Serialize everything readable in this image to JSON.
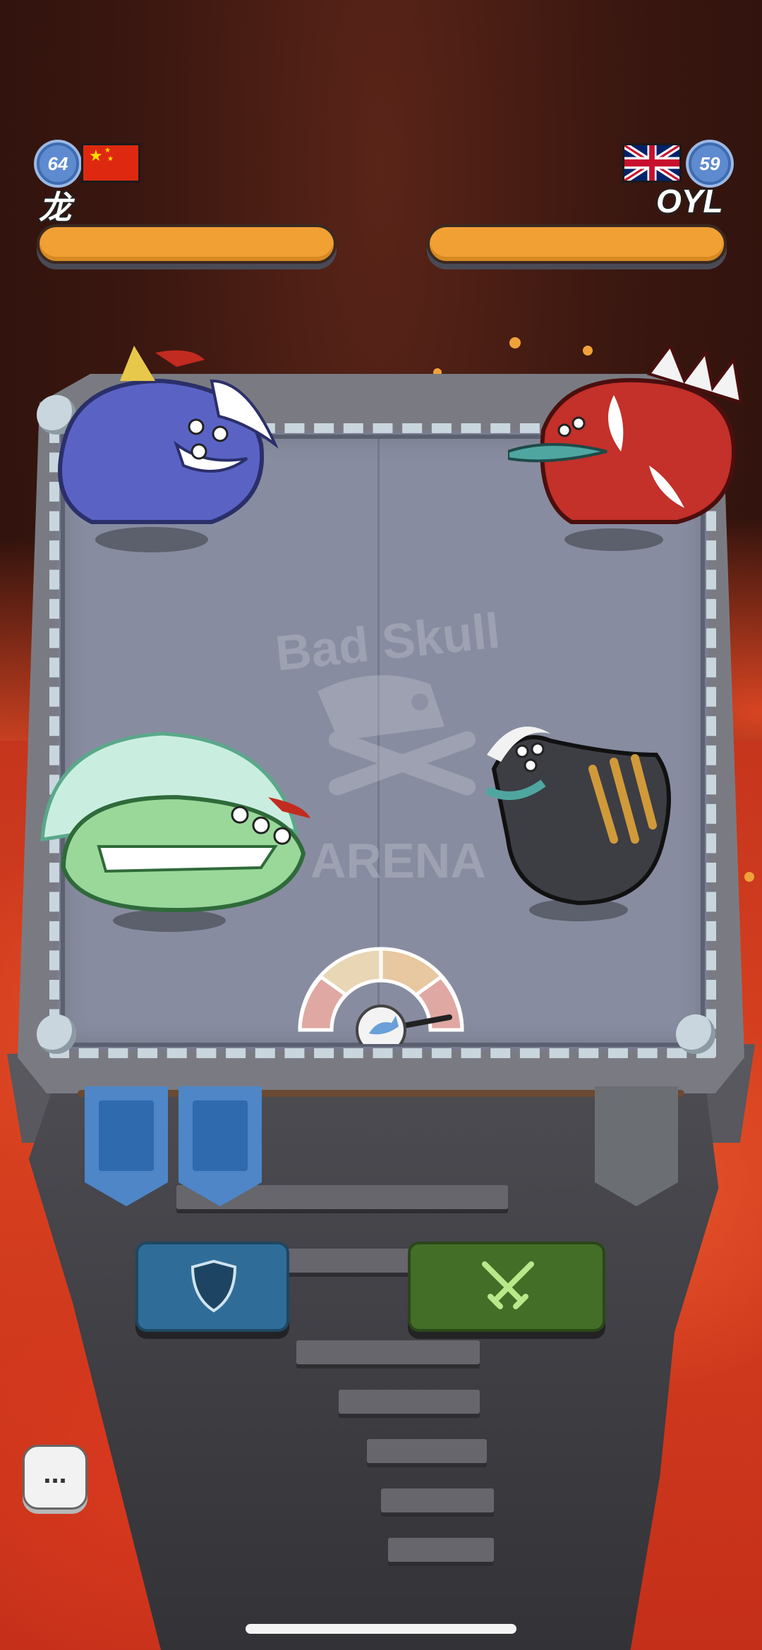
{
  "players": {
    "left": {
      "level": "64",
      "name": "龙",
      "flag": "china-flag"
    },
    "right": {
      "level": "59",
      "name": "OYL",
      "flag": "uk-flag"
    }
  },
  "arena": {
    "watermark_line1": "Bad Skull",
    "watermark_line2": "ARENA"
  },
  "monsters": [
    {
      "id": "blue-rhino-monster",
      "owner": "left"
    },
    {
      "id": "green-frill-monster",
      "owner": "left"
    },
    {
      "id": "red-spiky-monster",
      "owner": "right"
    },
    {
      "id": "black-striped-monster",
      "owner": "right"
    }
  ],
  "controls": {
    "defend_icon": "shield-icon",
    "attack_icon": "crossed-swords-icon",
    "chat_label": "..."
  },
  "colors": {
    "hp_bar": "#f1a034",
    "defend": "#2f6d98",
    "attack": "#436e27",
    "banner_active": "#4e86c8",
    "banner_inactive": "#6b6f74"
  }
}
